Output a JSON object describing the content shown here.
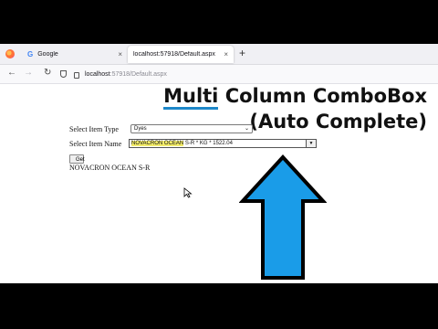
{
  "browser": {
    "tabs": [
      {
        "label": "Google",
        "close": "×"
      },
      {
        "label": "localhost:57918/Default.aspx",
        "close": "×"
      }
    ],
    "new_tab": "+",
    "url_host": "localhost",
    "url_path": ":57918/Default.aspx"
  },
  "headline": {
    "line1_underlined": "Multi",
    "line1_rest": " Column ComboBox",
    "line2": "(Auto Complete)"
  },
  "form": {
    "item_type_label": "Select Item Type",
    "item_type_value": "Dyes",
    "item_name_label": "Select Item Name",
    "item_name_highlight": "NOVACRON OCEAN",
    "item_name_rest": " S-R * KG * 1522.04",
    "get_button": "Get",
    "result": "NOVACRON OCEAN S-R"
  },
  "colors": {
    "arrow_fill": "#1a9ce8",
    "underline": "#1e88c9",
    "highlight": "#f3ec6a"
  }
}
